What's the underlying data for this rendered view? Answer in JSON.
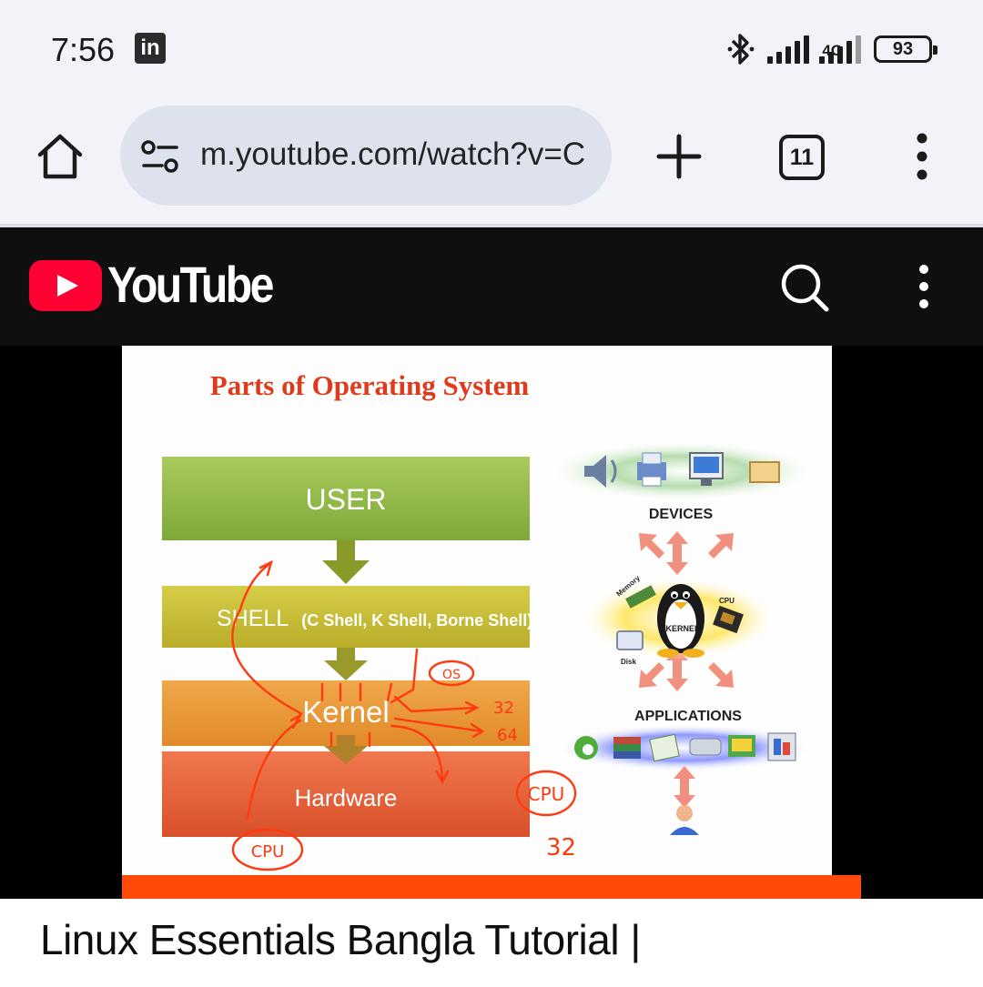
{
  "status_bar": {
    "time": "7:56",
    "app_badge": "in",
    "network": "4G",
    "battery": "93"
  },
  "browser": {
    "url": "m.youtube.com/watch?v=C",
    "tab_count": "11"
  },
  "youtube": {
    "wordmark": "YouTube",
    "brand_color": "#ff0000"
  },
  "slide": {
    "title": "Parts of Operating System",
    "layers": [
      "USER",
      "SHELL",
      "Kernel",
      "Hardware"
    ],
    "shell_note": "(C Shell, K Shell, Borne Shell)",
    "right_labels": {
      "devices": "DEVICES",
      "applications": "APPLICATIONS",
      "memory": "Memory",
      "cpu": "CPU",
      "disk": "Disk",
      "kernel": "KERNEL"
    },
    "annotations": {
      "os": "OS",
      "bits_32": "32",
      "bits_64": "64",
      "cpu_left": "CPU",
      "cpu_right": "CPU",
      "num_32": "32"
    }
  },
  "video": {
    "title": "Linux Essentials Bangla Tutorial |"
  }
}
